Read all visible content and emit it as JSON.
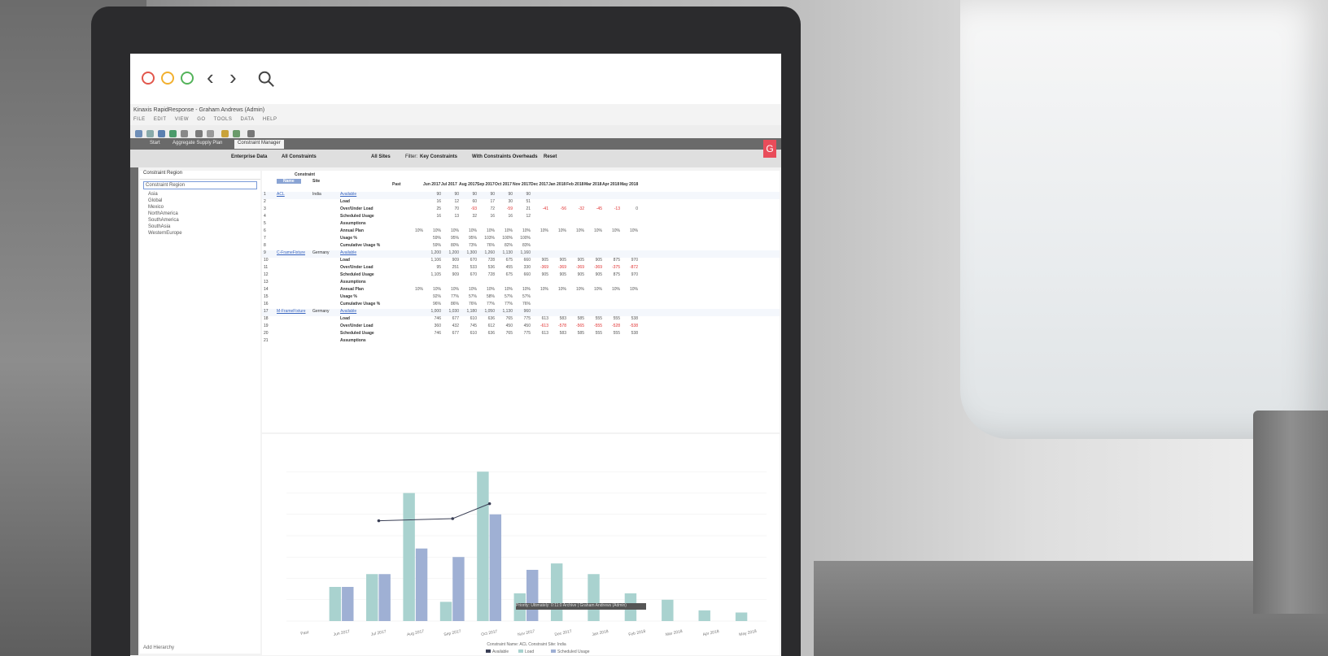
{
  "browser": {
    "back": "‹",
    "forward": "›",
    "refresh": "⟳",
    "menu": "⋮"
  },
  "app": {
    "title": "Kinaxis RapidResponse - Graham Andrews (Admin)",
    "menu": [
      "FILE",
      "EDIT",
      "VIEW",
      "GO",
      "TOOLS",
      "DATA",
      "HELP"
    ],
    "tabs": [
      "Start",
      "Aggregate Supply Plan",
      "Constraint Manager"
    ],
    "brand_badge": "G"
  },
  "secbar": {
    "hierarchy": "Enterprise Data",
    "constraints": "All Constraints",
    "sites": "All Sites",
    "filter_label": "Filter:",
    "filter_value": "Key Constraints",
    "overheads": "With Constraints Overheads",
    "reset": "Reset"
  },
  "tree": {
    "root": "Constraint Region",
    "selected": "Constraint Region",
    "items": [
      "Asia",
      "Global",
      "Mexico",
      "NorthAmerica",
      "SouthAmerica",
      "SouthAsia",
      "WesternEurope"
    ],
    "add": "Add Hierarchy"
  },
  "grid": {
    "header_group": "Constraint",
    "col_name": "Name",
    "col_site": "Site",
    "col_past": "Past",
    "months": [
      "Jun 2017",
      "Jul 2017",
      "Aug 2017",
      "Sep 2017",
      "Oct 2017",
      "Nov 2017",
      "Dec 2017",
      "Jan 2018",
      "Feb 2018",
      "Mar 2018",
      "Apr 2018",
      "May 2018"
    ],
    "rows": [
      {
        "n": "1",
        "name": "ACL",
        "site": "India",
        "label": "Available",
        "link": true,
        "vals": [
          "",
          "90",
          "90",
          "90",
          "90",
          "90",
          "90",
          "",
          "",
          "",
          "",
          "",
          ""
        ]
      },
      {
        "n": "2",
        "label": "Load",
        "vals": [
          "",
          "16",
          "12",
          "60",
          "17",
          "30",
          "51",
          "",
          "",
          "",
          "",
          "",
          ""
        ]
      },
      {
        "n": "3",
        "label": "Over/Under Load",
        "vals": [
          "",
          "25",
          "70",
          "-93",
          "72",
          "-59",
          "21",
          "-41",
          "-56",
          "-32",
          "-45",
          "-13",
          "0"
        ]
      },
      {
        "n": "4",
        "label": "Scheduled Usage",
        "vals": [
          "",
          "16",
          "13",
          "32",
          "16",
          "16",
          "12",
          "",
          "",
          "",
          "",
          "",
          ""
        ]
      },
      {
        "n": "5",
        "label": "Assumptions",
        "vals": [
          "",
          "",
          "",
          "",
          "",
          "",
          "",
          "",
          "",
          "",
          "",
          "",
          ""
        ]
      },
      {
        "n": "6",
        "label": "Annual Plan",
        "vals": [
          "10%",
          "10%",
          "10%",
          "10%",
          "10%",
          "10%",
          "10%",
          "10%",
          "10%",
          "10%",
          "10%",
          "10%",
          "10%"
        ]
      },
      {
        "n": "7",
        "label": "Usage %",
        "vals": [
          "",
          "59%",
          "95%",
          "95%",
          "103%",
          "100%",
          "100%",
          "",
          "",
          "",
          "",
          "",
          ""
        ]
      },
      {
        "n": "8",
        "label": "Cumulative Usage %",
        "vals": [
          "",
          "59%",
          "80%",
          "73%",
          "76%",
          "82%",
          "83%",
          "",
          "",
          "",
          "",
          "",
          ""
        ]
      },
      {
        "n": "9",
        "name": "C-FrameFixture",
        "site": "Germany",
        "label": "Available",
        "link": true,
        "vals": [
          "",
          "1,200",
          "1,200",
          "1,300",
          "1,260",
          "1,130",
          "1,160",
          "",
          "",
          "",
          "",
          "",
          ""
        ]
      },
      {
        "n": "10",
        "label": "Load",
        "vals": [
          "",
          "1,106",
          "909",
          "670",
          "728",
          "675",
          "660",
          "905",
          "905",
          "905",
          "905",
          "875",
          "970"
        ]
      },
      {
        "n": "11",
        "label": "Over/Under Load",
        "vals": [
          "",
          "95",
          "251",
          "533",
          "536",
          "455",
          "330",
          "-369",
          "-369",
          "-369",
          "-369",
          "-375",
          "-872"
        ]
      },
      {
        "n": "12",
        "label": "Scheduled Usage",
        "vals": [
          "",
          "1,105",
          "909",
          "670",
          "728",
          "675",
          "660",
          "905",
          "905",
          "905",
          "905",
          "875",
          "970"
        ]
      },
      {
        "n": "13",
        "label": "Assumptions",
        "vals": [
          "",
          "",
          "",
          "",
          "",
          "",
          "",
          "",
          "",
          "",
          "",
          "",
          ""
        ]
      },
      {
        "n": "14",
        "label": "Annual Plan",
        "vals": [
          "10%",
          "10%",
          "10%",
          "10%",
          "10%",
          "10%",
          "10%",
          "10%",
          "10%",
          "10%",
          "10%",
          "10%",
          "10%"
        ]
      },
      {
        "n": "15",
        "label": "Usage %",
        "vals": [
          "",
          "92%",
          "77%",
          "57%",
          "58%",
          "57%",
          "57%",
          "",
          "",
          "",
          "",
          "",
          ""
        ]
      },
      {
        "n": "16",
        "label": "Cumulative Usage %",
        "vals": [
          "",
          "96%",
          "86%",
          "76%",
          "77%",
          "77%",
          "76%",
          "",
          "",
          "",
          "",
          "",
          ""
        ]
      },
      {
        "n": "17",
        "name": "M-FrameFixture",
        "site": "Germany",
        "label": "Available",
        "link": true,
        "vals": [
          "",
          "1,000",
          "1,030",
          "1,180",
          "1,050",
          "1,130",
          "960",
          "",
          "",
          "",
          "",
          "",
          ""
        ]
      },
      {
        "n": "18",
        "label": "Load",
        "vals": [
          "",
          "746",
          "677",
          "610",
          "636",
          "765",
          "775",
          "613",
          "583",
          "585",
          "555",
          "555",
          "538"
        ]
      },
      {
        "n": "19",
        "label": "Over/Under Load",
        "vals": [
          "",
          "360",
          "432",
          "745",
          "612",
          "450",
          "450",
          "-613",
          "-578",
          "-565",
          "-555",
          "-528",
          "-538"
        ]
      },
      {
        "n": "20",
        "label": "Scheduled Usage",
        "vals": [
          "",
          "746",
          "677",
          "610",
          "636",
          "765",
          "775",
          "613",
          "583",
          "585",
          "555",
          "555",
          "538"
        ]
      },
      {
        "n": "21",
        "label": "Assumptions",
        "vals": [
          "",
          "",
          "",
          "",
          "",
          "",
          "",
          "",
          "",
          "",
          "",
          "",
          ""
        ]
      }
    ]
  },
  "chart_data": {
    "type": "bar",
    "title": "",
    "ylabel": "",
    "categories": [
      "Past",
      "Jun 2017",
      "Jul 2017",
      "Aug 2017",
      "Sep 2017",
      "Oct 2017",
      "Nov 2017",
      "Dec 2017",
      "Jan 2018",
      "Feb 2018",
      "Mar 2018",
      "Apr 2018",
      "May 2018"
    ],
    "ylim": [
      0,
      80
    ],
    "series": [
      {
        "name": "Available",
        "kind": "line",
        "color": "#3a3f55",
        "values": [
          null,
          null,
          47,
          null,
          48,
          55,
          null,
          null,
          null,
          null,
          null,
          null,
          null
        ]
      },
      {
        "name": "Load",
        "kind": "bar",
        "color": "#a9d2cf",
        "values": [
          0,
          16,
          22,
          60,
          9,
          70,
          13,
          27,
          22,
          13,
          10,
          5,
          4
        ]
      },
      {
        "name": "Scheduled Usage",
        "kind": "bar",
        "color": "#9fb0d4",
        "values": [
          0,
          16,
          22,
          34,
          30,
          50,
          24,
          0,
          0,
          0,
          0,
          0,
          0
        ]
      }
    ],
    "legend_caption": "Constraint Name: ACL      Constraint Site: India",
    "legend_items": [
      "Available",
      "Load",
      "Scheduled Usage"
    ]
  },
  "status": {
    "text": "Priority: Ultimately: 0:11:0 Archive  |  Graham Andrews (Admin)"
  }
}
